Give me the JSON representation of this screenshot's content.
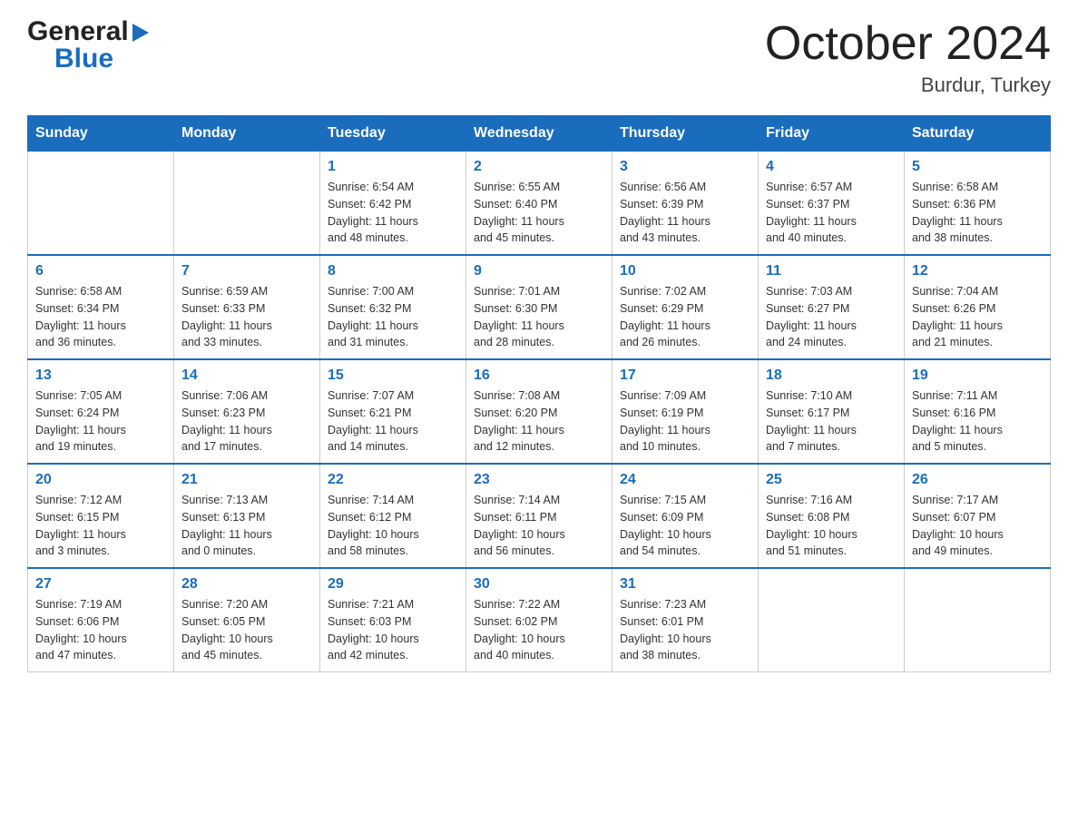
{
  "header": {
    "logo_line1": "General",
    "logo_line2": "Blue",
    "month_title": "October 2024",
    "location": "Burdur, Turkey"
  },
  "weekdays": [
    "Sunday",
    "Monday",
    "Tuesday",
    "Wednesday",
    "Thursday",
    "Friday",
    "Saturday"
  ],
  "weeks": [
    [
      {
        "day": "",
        "info": ""
      },
      {
        "day": "",
        "info": ""
      },
      {
        "day": "1",
        "info": "Sunrise: 6:54 AM\nSunset: 6:42 PM\nDaylight: 11 hours\nand 48 minutes."
      },
      {
        "day": "2",
        "info": "Sunrise: 6:55 AM\nSunset: 6:40 PM\nDaylight: 11 hours\nand 45 minutes."
      },
      {
        "day": "3",
        "info": "Sunrise: 6:56 AM\nSunset: 6:39 PM\nDaylight: 11 hours\nand 43 minutes."
      },
      {
        "day": "4",
        "info": "Sunrise: 6:57 AM\nSunset: 6:37 PM\nDaylight: 11 hours\nand 40 minutes."
      },
      {
        "day": "5",
        "info": "Sunrise: 6:58 AM\nSunset: 6:36 PM\nDaylight: 11 hours\nand 38 minutes."
      }
    ],
    [
      {
        "day": "6",
        "info": "Sunrise: 6:58 AM\nSunset: 6:34 PM\nDaylight: 11 hours\nand 36 minutes."
      },
      {
        "day": "7",
        "info": "Sunrise: 6:59 AM\nSunset: 6:33 PM\nDaylight: 11 hours\nand 33 minutes."
      },
      {
        "day": "8",
        "info": "Sunrise: 7:00 AM\nSunset: 6:32 PM\nDaylight: 11 hours\nand 31 minutes."
      },
      {
        "day": "9",
        "info": "Sunrise: 7:01 AM\nSunset: 6:30 PM\nDaylight: 11 hours\nand 28 minutes."
      },
      {
        "day": "10",
        "info": "Sunrise: 7:02 AM\nSunset: 6:29 PM\nDaylight: 11 hours\nand 26 minutes."
      },
      {
        "day": "11",
        "info": "Sunrise: 7:03 AM\nSunset: 6:27 PM\nDaylight: 11 hours\nand 24 minutes."
      },
      {
        "day": "12",
        "info": "Sunrise: 7:04 AM\nSunset: 6:26 PM\nDaylight: 11 hours\nand 21 minutes."
      }
    ],
    [
      {
        "day": "13",
        "info": "Sunrise: 7:05 AM\nSunset: 6:24 PM\nDaylight: 11 hours\nand 19 minutes."
      },
      {
        "day": "14",
        "info": "Sunrise: 7:06 AM\nSunset: 6:23 PM\nDaylight: 11 hours\nand 17 minutes."
      },
      {
        "day": "15",
        "info": "Sunrise: 7:07 AM\nSunset: 6:21 PM\nDaylight: 11 hours\nand 14 minutes."
      },
      {
        "day": "16",
        "info": "Sunrise: 7:08 AM\nSunset: 6:20 PM\nDaylight: 11 hours\nand 12 minutes."
      },
      {
        "day": "17",
        "info": "Sunrise: 7:09 AM\nSunset: 6:19 PM\nDaylight: 11 hours\nand 10 minutes."
      },
      {
        "day": "18",
        "info": "Sunrise: 7:10 AM\nSunset: 6:17 PM\nDaylight: 11 hours\nand 7 minutes."
      },
      {
        "day": "19",
        "info": "Sunrise: 7:11 AM\nSunset: 6:16 PM\nDaylight: 11 hours\nand 5 minutes."
      }
    ],
    [
      {
        "day": "20",
        "info": "Sunrise: 7:12 AM\nSunset: 6:15 PM\nDaylight: 11 hours\nand 3 minutes."
      },
      {
        "day": "21",
        "info": "Sunrise: 7:13 AM\nSunset: 6:13 PM\nDaylight: 11 hours\nand 0 minutes."
      },
      {
        "day": "22",
        "info": "Sunrise: 7:14 AM\nSunset: 6:12 PM\nDaylight: 10 hours\nand 58 minutes."
      },
      {
        "day": "23",
        "info": "Sunrise: 7:14 AM\nSunset: 6:11 PM\nDaylight: 10 hours\nand 56 minutes."
      },
      {
        "day": "24",
        "info": "Sunrise: 7:15 AM\nSunset: 6:09 PM\nDaylight: 10 hours\nand 54 minutes."
      },
      {
        "day": "25",
        "info": "Sunrise: 7:16 AM\nSunset: 6:08 PM\nDaylight: 10 hours\nand 51 minutes."
      },
      {
        "day": "26",
        "info": "Sunrise: 7:17 AM\nSunset: 6:07 PM\nDaylight: 10 hours\nand 49 minutes."
      }
    ],
    [
      {
        "day": "27",
        "info": "Sunrise: 7:19 AM\nSunset: 6:06 PM\nDaylight: 10 hours\nand 47 minutes."
      },
      {
        "day": "28",
        "info": "Sunrise: 7:20 AM\nSunset: 6:05 PM\nDaylight: 10 hours\nand 45 minutes."
      },
      {
        "day": "29",
        "info": "Sunrise: 7:21 AM\nSunset: 6:03 PM\nDaylight: 10 hours\nand 42 minutes."
      },
      {
        "day": "30",
        "info": "Sunrise: 7:22 AM\nSunset: 6:02 PM\nDaylight: 10 hours\nand 40 minutes."
      },
      {
        "day": "31",
        "info": "Sunrise: 7:23 AM\nSunset: 6:01 PM\nDaylight: 10 hours\nand 38 minutes."
      },
      {
        "day": "",
        "info": ""
      },
      {
        "day": "",
        "info": ""
      }
    ]
  ]
}
